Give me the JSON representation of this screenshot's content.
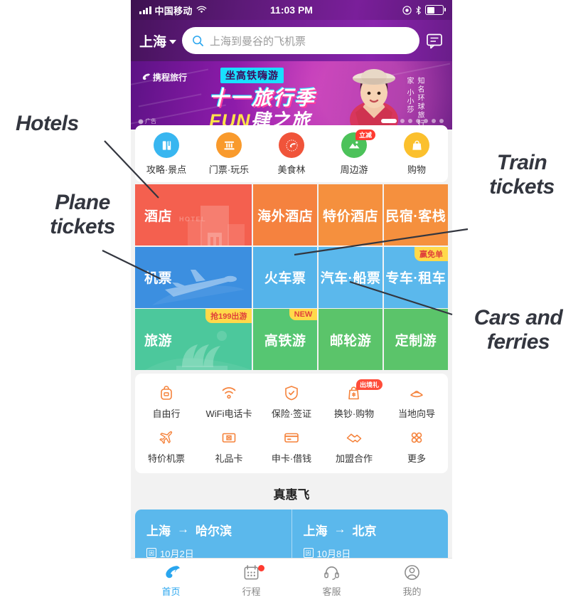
{
  "annotations": [
    {
      "id": "hotels",
      "text": "Hotels"
    },
    {
      "id": "plane",
      "text": "Plane\ntickets"
    },
    {
      "id": "train",
      "text": "Train\ntickets"
    },
    {
      "id": "cars",
      "text": "Cars and\nferries"
    }
  ],
  "status_bar": {
    "carrier": "中国移动",
    "time": "11:03 PM",
    "signal_icon": "signal-bars-icon",
    "wifi_icon": "wifi-icon",
    "alarm_icon": "do-not-disturb-icon",
    "bluetooth_icon": "bluetooth-icon",
    "battery_icon": "battery-icon"
  },
  "header": {
    "city": "上海",
    "city_caret_icon": "chevron-down-icon",
    "search_icon": "search-icon",
    "search_placeholder": "上海到曼谷的飞机票",
    "search_value": "",
    "message_icon": "message-icon"
  },
  "banner": {
    "brand": "携程旅行",
    "line1": "坐高铁嗨游",
    "line2": "十一旅行季",
    "line3_a": "FUN",
    "line3_b": "肆之旅",
    "vertical": "知名环球旅行家 小小莎",
    "ad_label": "广告",
    "dots_total": 7,
    "dot_active": 0
  },
  "quick_icons": [
    {
      "label": "攻略·景点",
      "icon": "guide-attractions-icon",
      "color": "#38b6f0",
      "badge": null
    },
    {
      "label": "门票·玩乐",
      "icon": "tickets-fun-icon",
      "color": "#f99a2c",
      "badge": null
    },
    {
      "label": "美食林",
      "icon": "food-forest-icon",
      "color": "#f0543a",
      "badge": null
    },
    {
      "label": "周边游",
      "icon": "nearby-travel-icon",
      "color": "#4cc25a",
      "badge": "立减"
    },
    {
      "label": "购物",
      "icon": "shopping-bag-icon",
      "color": "#fbc02d",
      "badge": null
    }
  ],
  "tile_rows": [
    {
      "name": "hotel-row",
      "tiles": [
        {
          "label": "酒店",
          "wide": true,
          "color": "#f4604f",
          "badge": null,
          "badge_color": null,
          "badge_text_color": null,
          "art": "hotel-building-art"
        },
        {
          "label": "海外酒店",
          "wide": false,
          "color": "#f5823f",
          "badge": null,
          "badge_color": null,
          "badge_text_color": null,
          "art": null
        },
        {
          "label": "特价酒店",
          "wide": false,
          "color": "#f5903e",
          "badge": null,
          "badge_color": null,
          "badge_text_color": null,
          "art": null
        },
        {
          "label": "民宿·客栈",
          "wide": false,
          "color": "#f5903e",
          "badge": null,
          "badge_color": null,
          "badge_text_color": null,
          "art": null
        }
      ]
    },
    {
      "name": "transport-row",
      "tiles": [
        {
          "label": "机票",
          "wide": true,
          "color": "#3c8fe0",
          "badge": null,
          "badge_color": null,
          "badge_text_color": null,
          "art": "airplane-art"
        },
        {
          "label": "火车票",
          "wide": false,
          "color": "#55b4ea",
          "badge": null,
          "badge_color": null,
          "badge_text_color": null,
          "art": null
        },
        {
          "label": "汽车·船票",
          "wide": false,
          "color": "#5bb8ec",
          "badge": null,
          "badge_color": null,
          "badge_text_color": null,
          "art": null
        },
        {
          "label": "专车·租车",
          "wide": false,
          "color": "#5bb8ec",
          "badge": "赢免单",
          "badge_color": "#ffd94a",
          "badge_text_color": "#e0413a",
          "art": null
        }
      ]
    },
    {
      "name": "tour-row",
      "tiles": [
        {
          "label": "旅游",
          "wide": true,
          "color": "#4cc89c",
          "badge": "抢199出游",
          "badge_color": "#ffd94a",
          "badge_text_color": "#e0413a",
          "art": "opera-house-art"
        },
        {
          "label": "高铁游",
          "wide": false,
          "color": "#56c672",
          "badge": "NEW",
          "badge_color": "#ffd94a",
          "badge_text_color": "#e0413a",
          "art": null
        },
        {
          "label": "邮轮游",
          "wide": false,
          "color": "#5bc46a",
          "badge": null,
          "badge_color": null,
          "badge_text_color": null,
          "art": null
        },
        {
          "label": "定制游",
          "wide": false,
          "color": "#5bc46a",
          "badge": null,
          "badge_color": null,
          "badge_text_color": null,
          "art": null
        }
      ]
    }
  ],
  "service_rows": [
    [
      {
        "label": "自由行",
        "icon": "backpack-icon",
        "badge": null
      },
      {
        "label": "WiFi电话卡",
        "icon": "wifi-icon",
        "badge": null
      },
      {
        "label": "保险·签证",
        "icon": "shield-check-icon",
        "badge": null
      },
      {
        "label": "换钞·购物",
        "icon": "currency-exchange-icon",
        "badge": "出境礼"
      },
      {
        "label": "当地向导",
        "icon": "local-guide-hat-icon",
        "badge": null
      }
    ],
    [
      {
        "label": "特价机票",
        "icon": "airplane-icon",
        "badge": null
      },
      {
        "label": "礼品卡",
        "icon": "gift-card-icon",
        "badge": null
      },
      {
        "label": "申卡·借钱",
        "icon": "credit-card-icon",
        "badge": null
      },
      {
        "label": "加盟合作",
        "icon": "handshake-icon",
        "badge": null
      },
      {
        "label": "更多",
        "icon": "more-grid-icon",
        "badge": null
      }
    ]
  ],
  "deals": {
    "title": "真惠飞",
    "cards": [
      {
        "from": "上海",
        "arrow": "→",
        "to": "哈尔滨",
        "date": "10月2日",
        "date_icon": "calendar-icon"
      },
      {
        "from": "上海",
        "arrow": "→",
        "to": "北京",
        "date": "10月8日",
        "date_icon": "calendar-icon"
      }
    ]
  },
  "tab_bar": [
    {
      "label": "首页",
      "icon": "ctrip-dolphin-icon",
      "active": true,
      "dot": false
    },
    {
      "label": "行程",
      "icon": "calendar-icon",
      "active": false,
      "dot": true
    },
    {
      "label": "客服",
      "icon": "headset-icon",
      "active": false,
      "dot": false
    },
    {
      "label": "我的",
      "icon": "person-icon",
      "active": false,
      "dot": false
    }
  ],
  "colors": {
    "brand_blue": "#2aa6ef",
    "accent_orange": "#f5833c",
    "badge_red": "#ff3b30",
    "badge_yellow": "#ffd94a"
  }
}
